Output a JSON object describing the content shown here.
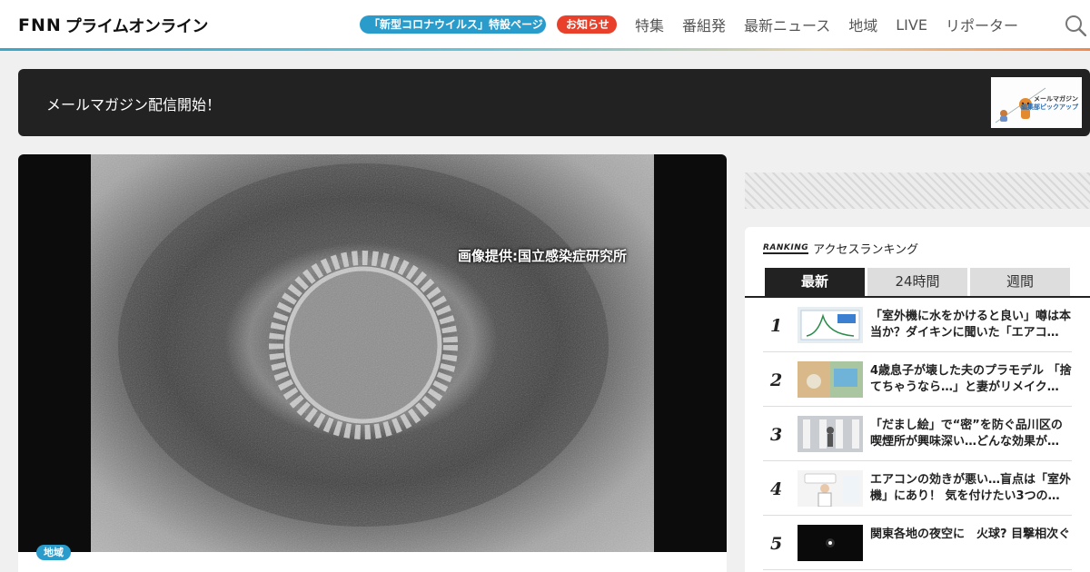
{
  "header": {
    "logo": {
      "fnn": "FNN",
      "text": "プライムオンライン"
    },
    "corona_pill": "「新型コロナウイルス」特設ページ",
    "news_pill": "お知らせ",
    "nav": [
      "特集",
      "番組発",
      "最新ニュース",
      "地域",
      "LIVE",
      "リポーター"
    ],
    "search_icon": "search-icon"
  },
  "banner": {
    "text": "メールマガジン配信開始！",
    "thumb_line1": "メールマガジン",
    "thumb_line2": "編集部ピックアップ"
  },
  "hero": {
    "caption": "画像提供:国立感染症研究所",
    "tag": "地域"
  },
  "ranking": {
    "logo": "RANKING",
    "title": "アクセスランキング",
    "tabs": [
      "最新",
      "24時間",
      "週間"
    ],
    "items": [
      {
        "rank": "1",
        "title": "「室外機に水をかけると良い」噂は本当か？ダイキンに聞いた「エアコ…"
      },
      {
        "rank": "2",
        "title": "4歳息子が壊した夫のプラモデル 「捨てちゃうなら…」と妻がリメイク…"
      },
      {
        "rank": "3",
        "title": "「だまし絵」で“密”を防ぐ品川区の喫煙所が興味深い…どんな効果が…"
      },
      {
        "rank": "4",
        "title": "エアコンの効きが悪い…盲点は「室外機」にあり！ 気を付けたい3つの…"
      },
      {
        "rank": "5",
        "title": "関東各地の夜空に　火球? 目撃相次ぐ"
      }
    ]
  },
  "colors": {
    "accent_blue": "#2a9ccc",
    "accent_red": "#e8402a",
    "dark": "#222222"
  }
}
